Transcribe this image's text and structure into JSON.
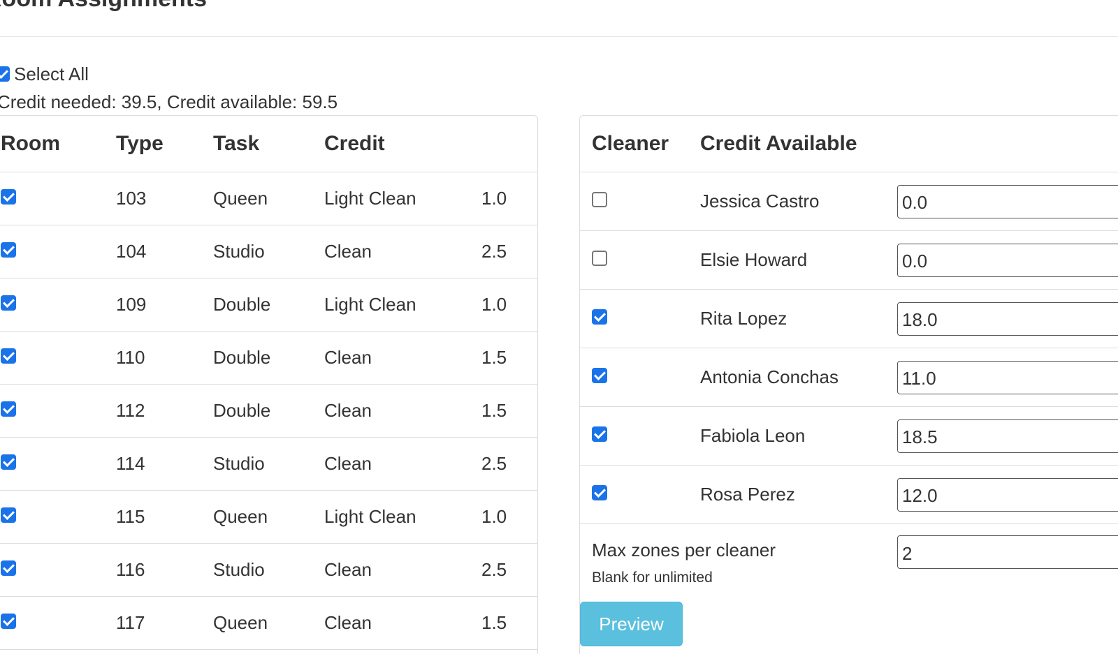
{
  "page": {
    "title": "Room Assignments"
  },
  "select_all": {
    "label": "Select All",
    "checked": true
  },
  "summary": {
    "credit_text": "Credit needed: 39.5, Credit available: 59.5"
  },
  "rooms": {
    "headers": [
      "Room",
      "Type",
      "Task",
      "Credit"
    ],
    "rows": [
      {
        "checked": true,
        "room": "103",
        "type": "Queen",
        "task": "Light Clean",
        "credit": "1.0"
      },
      {
        "checked": true,
        "room": "104",
        "type": "Studio",
        "task": "Clean",
        "credit": "2.5"
      },
      {
        "checked": true,
        "room": "109",
        "type": "Double",
        "task": "Light Clean",
        "credit": "1.0"
      },
      {
        "checked": true,
        "room": "110",
        "type": "Double",
        "task": "Clean",
        "credit": "1.5"
      },
      {
        "checked": true,
        "room": "112",
        "type": "Double",
        "task": "Clean",
        "credit": "1.5"
      },
      {
        "checked": true,
        "room": "114",
        "type": "Studio",
        "task": "Clean",
        "credit": "2.5"
      },
      {
        "checked": true,
        "room": "115",
        "type": "Queen",
        "task": "Light Clean",
        "credit": "1.0"
      },
      {
        "checked": true,
        "room": "116",
        "type": "Studio",
        "task": "Clean",
        "credit": "2.5"
      },
      {
        "checked": true,
        "room": "117",
        "type": "Queen",
        "task": "Clean",
        "credit": "1.5"
      }
    ]
  },
  "cleaners": {
    "headers": [
      "Cleaner",
      "Credit Available"
    ],
    "rows": [
      {
        "checked": false,
        "name": "Jessica Castro",
        "credit": "0.0"
      },
      {
        "checked": false,
        "name": "Elsie Howard",
        "credit": "0.0"
      },
      {
        "checked": true,
        "name": "Rita Lopez",
        "credit": "18.0"
      },
      {
        "checked": true,
        "name": "Antonia Conchas",
        "credit": "11.0"
      },
      {
        "checked": true,
        "name": "Fabiola Leon",
        "credit": "18.5"
      },
      {
        "checked": true,
        "name": "Rosa Perez",
        "credit": "12.0"
      }
    ],
    "max_zones": {
      "label": "Max zones per cleaner",
      "hint": "Blank for unlimited",
      "value": "2"
    }
  },
  "actions": {
    "preview_label": "Preview"
  },
  "colors": {
    "checkbox_on": "#1a73e8",
    "preview_button": "#5bc0de",
    "border": "#dddddd",
    "text": "#333333"
  }
}
